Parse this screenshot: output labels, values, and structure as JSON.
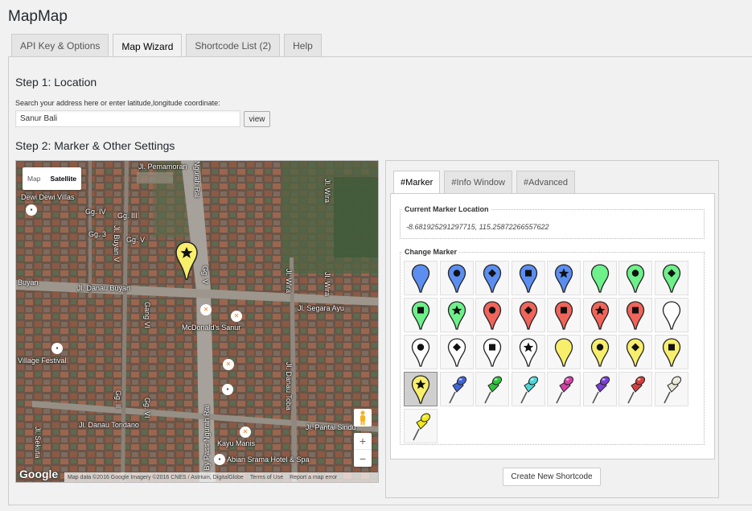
{
  "app": {
    "title": "MapMap"
  },
  "tabs": [
    {
      "label": "API Key & Options",
      "active": false
    },
    {
      "label": "Map Wizard",
      "active": true
    },
    {
      "label": "Shortcode List (2)",
      "active": false
    },
    {
      "label": "Help",
      "active": false
    }
  ],
  "step1": {
    "title": "Step 1: Location",
    "hint": "Search your address here or enter latitude,longitude coordinate:",
    "address_value": "Sanur Bali",
    "view_label": "view"
  },
  "step2": {
    "title": "Step 2: Marker & Other Settings"
  },
  "map": {
    "type_buttons": [
      "Map",
      "Satellite"
    ],
    "selected_type": "Satellite",
    "labels": {
      "street_pemamoran": "Jl. Pemamoran",
      "street_ngurah_rai_top": "Ngurah Rai",
      "street_wira_top": "Jl. Wira",
      "dewi_dewi_villas": "Dewi Dewi Villas",
      "gg_iv": "Gg. IV",
      "gg_iii": "Gg. III",
      "gg_3": "Gg. 3",
      "gg_v_left": "Gg. V",
      "buyan_v": "Jl. Buyan V",
      "gg_v_right": "Gg. V",
      "buyan": "Buyan",
      "danau_buyan": "Jl. Danau Buyan",
      "wira_mid": "Jl. Wira",
      "wira_right": "Jl. Wira",
      "segara_ayu": "Jl. Segara Ayu",
      "gang_vi": "Gang VI",
      "mcdonalds": "McDonald's Sanur",
      "village_festival": "Village Festival",
      "gg_ii": "Gg. II",
      "gg_vi": "Gg. VI",
      "danau_tondano": "Jl. Danau Tondano",
      "sekuta": "Jl. Sekuta",
      "bypass": "Jl. By Pass Ngurah Rai",
      "danau_toba": "Jl. Danau Toba",
      "pantai_sindu": "Jl. Pantai Sindu",
      "kayu_manis": "Kayu Manis",
      "abian_srama": "Abian Srama Hotel & Spa"
    },
    "zoom_in": "+",
    "zoom_out": "−",
    "google_logo": "Google",
    "footer": [
      "Map data ©2016 Google Imagery ©2016 CNES / Astrium, DigitalGlobe",
      "Terms of Use",
      "Report a map error"
    ],
    "marker_color": "#f7ef6b"
  },
  "settings": {
    "tabs": [
      {
        "label": "#Marker",
        "active": true
      },
      {
        "label": "#Info Window",
        "active": false
      },
      {
        "label": "#Advanced",
        "active": false
      }
    ],
    "current_location_legend": "Current Marker Location",
    "current_location_value": "-8.681925291297715, 115.25872266557622",
    "change_marker_legend": "Change Marker",
    "selected_marker_index": 24,
    "markers": [
      {
        "shape": "pin",
        "color": "#5b8ef0",
        "symbol": "none"
      },
      {
        "shape": "pin",
        "color": "#5b8ef0",
        "symbol": "circle"
      },
      {
        "shape": "pin",
        "color": "#5b8ef0",
        "symbol": "diamond"
      },
      {
        "shape": "pin",
        "color": "#5b8ef0",
        "symbol": "square"
      },
      {
        "shape": "pin",
        "color": "#5b8ef0",
        "symbol": "star"
      },
      {
        "shape": "pin",
        "color": "#6ef08a",
        "symbol": "none"
      },
      {
        "shape": "pin",
        "color": "#6ef08a",
        "symbol": "circle"
      },
      {
        "shape": "pin",
        "color": "#6ef08a",
        "symbol": "diamond"
      },
      {
        "shape": "pin",
        "color": "#6ef08a",
        "symbol": "square"
      },
      {
        "shape": "pin",
        "color": "#6ef08a",
        "symbol": "star"
      },
      {
        "shape": "pin",
        "color": "#f0645a",
        "symbol": "circle"
      },
      {
        "shape": "pin",
        "color": "#f0645a",
        "symbol": "diamond"
      },
      {
        "shape": "pin",
        "color": "#f0645a",
        "symbol": "square"
      },
      {
        "shape": "pin",
        "color": "#f0645a",
        "symbol": "star"
      },
      {
        "shape": "pin",
        "color": "#f0645a",
        "symbol": "square"
      },
      {
        "shape": "pin",
        "color": "#ffffff",
        "symbol": "none"
      },
      {
        "shape": "pin",
        "color": "#ffffff",
        "symbol": "circle"
      },
      {
        "shape": "pin",
        "color": "#ffffff",
        "symbol": "diamond"
      },
      {
        "shape": "pin",
        "color": "#ffffff",
        "symbol": "square"
      },
      {
        "shape": "pin",
        "color": "#ffffff",
        "symbol": "star"
      },
      {
        "shape": "pin",
        "color": "#f7ef6b",
        "symbol": "none"
      },
      {
        "shape": "pin",
        "color": "#f7ef6b",
        "symbol": "circle"
      },
      {
        "shape": "pin",
        "color": "#f7ef6b",
        "symbol": "diamond"
      },
      {
        "shape": "pin",
        "color": "#f7ef6b",
        "symbol": "square"
      },
      {
        "shape": "pin",
        "color": "#f7ef6b",
        "symbol": "star"
      },
      {
        "shape": "pushpin",
        "color": "#3f66d8",
        "symbol": "none"
      },
      {
        "shape": "pushpin",
        "color": "#2ec43a",
        "symbol": "none"
      },
      {
        "shape": "pushpin",
        "color": "#4cd6d6",
        "symbol": "none"
      },
      {
        "shape": "pushpin",
        "color": "#d63fa8",
        "symbol": "none"
      },
      {
        "shape": "pushpin",
        "color": "#7a3fd6",
        "symbol": "none"
      },
      {
        "shape": "pushpin",
        "color": "#d63f3f",
        "symbol": "none"
      },
      {
        "shape": "pushpin",
        "color": "#e8e8d8",
        "symbol": "none"
      },
      {
        "shape": "pushpin",
        "color": "#f2ea1a",
        "symbol": "none"
      }
    ],
    "create_label": "Create New Shortcode"
  }
}
